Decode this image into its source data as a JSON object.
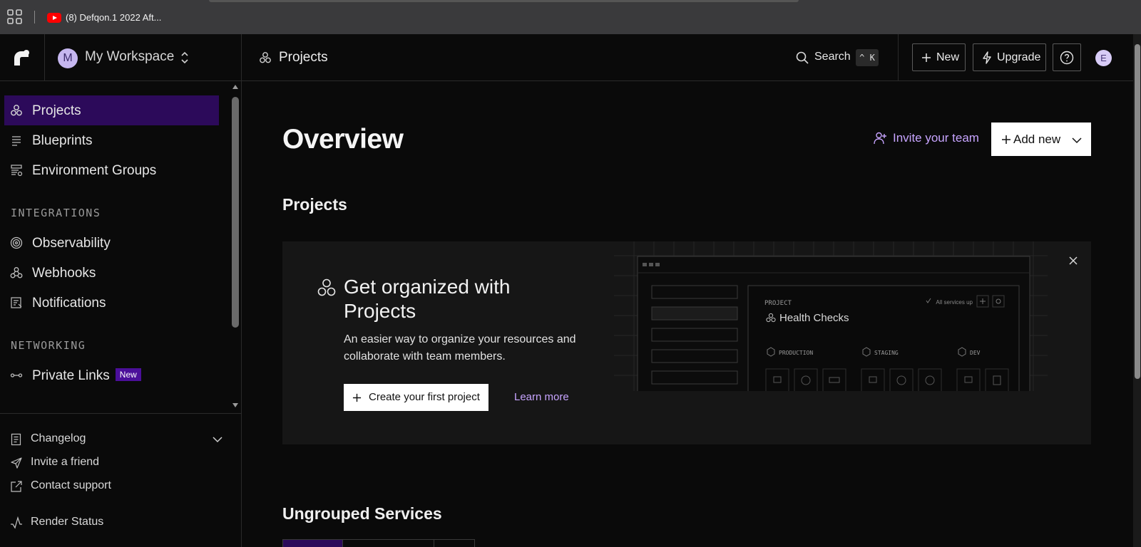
{
  "browser": {
    "tab_title": "(8) Defqon.1 2022 Aft..."
  },
  "header": {
    "workspace_initial": "M",
    "workspace_name": "My Workspace",
    "breadcrumb": "Projects",
    "search_label": "Search",
    "search_shortcut": "^ K",
    "new_label": "New",
    "upgrade_label": "Upgrade",
    "user_initial": "E"
  },
  "sidebar": {
    "items": [
      {
        "label": "Projects",
        "icon": "projects-icon",
        "active": true
      },
      {
        "label": "Blueprints",
        "icon": "blueprints-icon"
      },
      {
        "label": "Environment Groups",
        "icon": "environment-groups-icon"
      }
    ],
    "integrations_label": "INTEGRATIONS",
    "integrations": [
      {
        "label": "Observability",
        "icon": "observability-icon"
      },
      {
        "label": "Webhooks",
        "icon": "webhooks-icon"
      },
      {
        "label": "Notifications",
        "icon": "notifications-icon"
      }
    ],
    "networking_label": "NETWORKING",
    "networking": [
      {
        "label": "Private Links",
        "icon": "private-links-icon",
        "badge": "New"
      }
    ],
    "footer": [
      {
        "label": "Changelog",
        "icon": "changelog-icon"
      },
      {
        "label": "Invite a friend",
        "icon": "send-icon"
      },
      {
        "label": "Contact support",
        "icon": "external-link-icon"
      },
      {
        "label": "Render Status",
        "icon": "status-pulse-icon"
      }
    ]
  },
  "main": {
    "title": "Overview",
    "invite_label": "Invite your team",
    "add_new_label": "Add new",
    "projects_heading": "Projects",
    "promo": {
      "title": "Get organized with Projects",
      "description": "An easier way to organize your resources and collaborate with team members.",
      "cta_label": "Create your first project",
      "learn_more_label": "Learn more",
      "illustration": {
        "project_label": "PROJECT",
        "project_name": "Health Checks",
        "status": "All services up",
        "environments": [
          "PRODUCTION",
          "STAGING",
          "DEV"
        ]
      }
    },
    "ungrouped_heading": "Ungrouped Services"
  },
  "colors": {
    "accent": "#c7a4ff",
    "active_nav": "#2c0a5a",
    "badge": "#4b0f9a",
    "background": "#0a0a0a",
    "card": "#161616"
  }
}
